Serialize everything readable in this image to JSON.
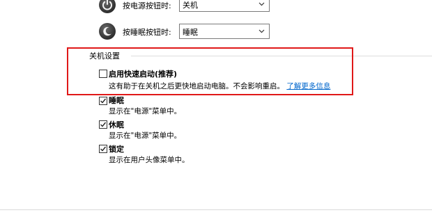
{
  "power_button": {
    "label": "按电源按钮时:",
    "value": "关机",
    "icon": "power-icon"
  },
  "sleep_button": {
    "label": "按睡眠按钮时:",
    "value": "睡眠",
    "icon": "moon-icon"
  },
  "shutdown_settings": {
    "title": "关机设置",
    "options": [
      {
        "label": "启用快速启动(推荐)",
        "checked": false,
        "description": "这有助于在关机之后更快地启动电脑。不会影响重启。",
        "link": "了解更多信息"
      },
      {
        "label": "睡眠",
        "checked": true,
        "description": "显示在\"电源\"菜单中。"
      },
      {
        "label": "休眠",
        "checked": true,
        "description": "显示在\"电源\"菜单中。"
      },
      {
        "label": "锁定",
        "checked": true,
        "description": "显示在用户头像菜单中。"
      }
    ]
  },
  "colors": {
    "highlight_box": "#e01818",
    "link": "#0066cc"
  }
}
